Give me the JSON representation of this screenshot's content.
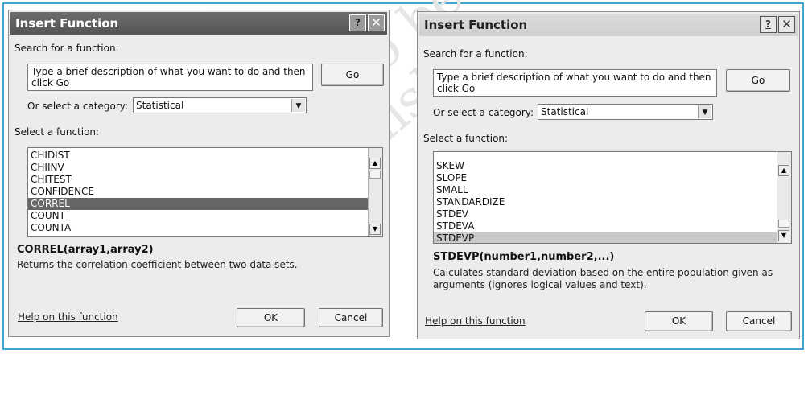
{
  "dialog_left": {
    "title": "Insert Function",
    "help_glyph": "?",
    "close_glyph": "✕",
    "search_label": "Search for a function:",
    "search_text": "Type a brief description of what you want to do and then click Go",
    "go_label": "Go",
    "category_label": "Or select a category:",
    "category_value": "Statistical",
    "function_label": "Select a function:",
    "functions": [
      "CHIDIST",
      "CHIINV",
      "CHITEST",
      "CONFIDENCE",
      "CORREL",
      "COUNT",
      "COUNTA"
    ],
    "selected_function": "CORREL",
    "signature": "CORREL(array1,array2)",
    "description": "Returns the correlation coefficient between two data sets.",
    "help_link": "Help on this function",
    "ok_label": "OK",
    "cancel_label": "Cancel"
  },
  "dialog_right": {
    "title": "Insert Function",
    "help_glyph": "?",
    "close_glyph": "✕",
    "search_label": "Search for a function:",
    "search_text": "Type a brief description of what you want to do and then click Go",
    "go_label": "Go",
    "category_label": "Or select a category:",
    "category_value": "Statistical",
    "function_label": "Select a function:",
    "functions": [
      "SKEW",
      "SLOPE",
      "SMALL",
      "STANDARDIZE",
      "STDEV",
      "STDEVA",
      "STDEVP"
    ],
    "selected_function": "STDEVP",
    "signature": "STDEVP(number1,number2,...)",
    "description": "Calculates standard deviation based on the entire population given as arguments (ignores logical values and text).",
    "help_link": "Help on this function",
    "ok_label": "OK",
    "cancel_label": "Cancel"
  },
  "watermark": "© not to be republished",
  "colors": {
    "frame": "#3fa6d6",
    "selection": "#666666",
    "dialog_bg": "#ececec"
  }
}
